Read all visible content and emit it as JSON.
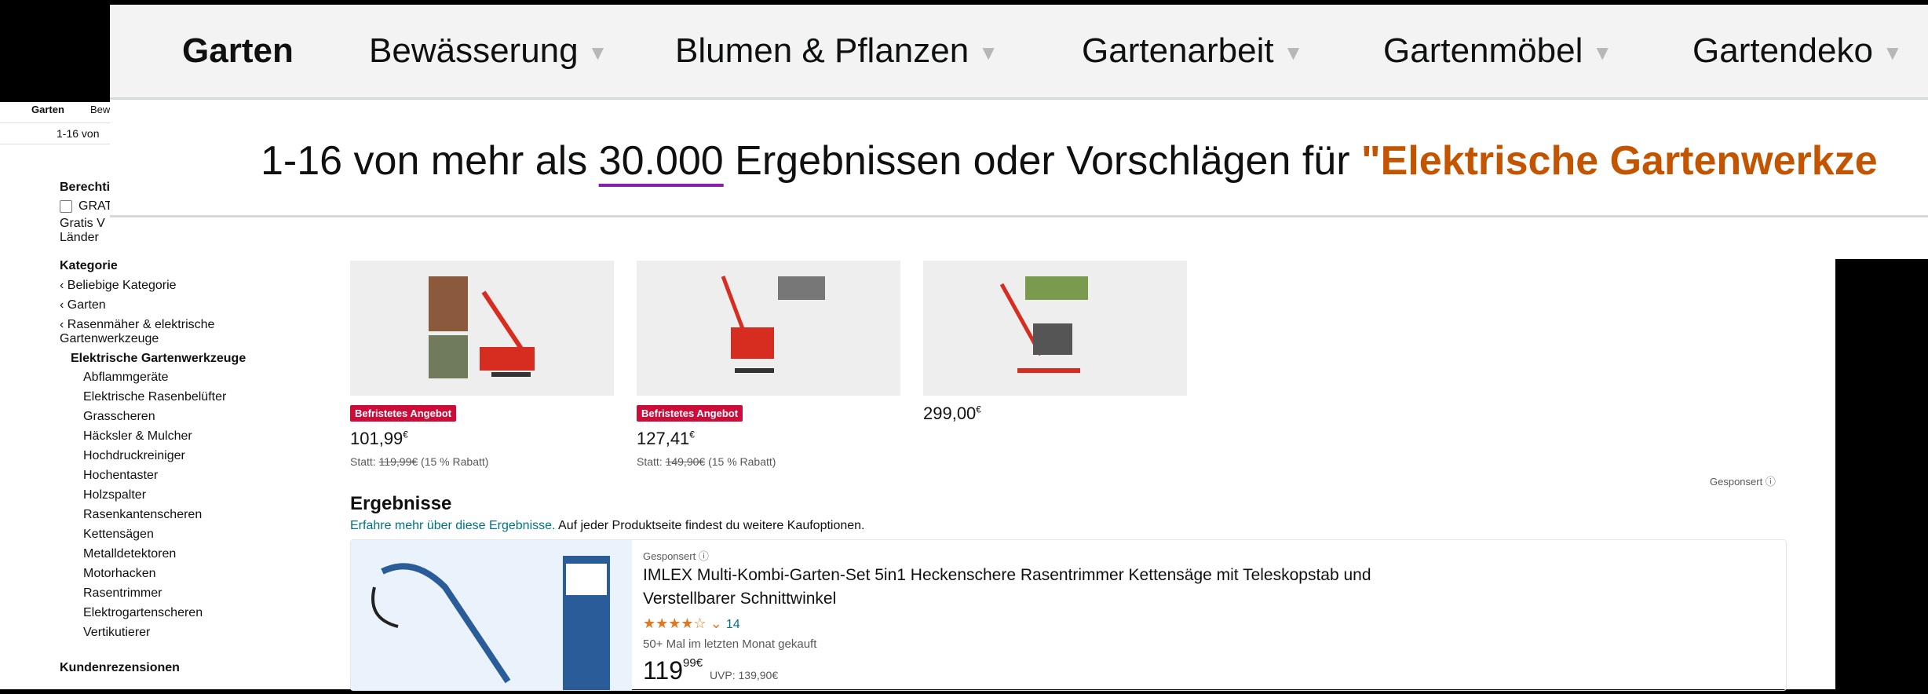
{
  "nav": {
    "items": [
      {
        "label": "Garten",
        "bold": true
      },
      {
        "label": "Bewässerung",
        "caret": true
      },
      {
        "label": "Blumen & Pflanzen",
        "caret": true
      },
      {
        "label": "Gartenarbeit",
        "caret": true
      },
      {
        "label": "Gartenmöbel",
        "caret": true
      },
      {
        "label": "Gartendeko",
        "caret": true
      }
    ],
    "bg_short": [
      "Garten",
      "Bew"
    ]
  },
  "results": {
    "prefix": "1-16 von mehr als ",
    "count": "30.000",
    "middle": " Ergebnissen oder Vorschlägen für ",
    "query": "\"Elektrische Gartenwerkze",
    "bg_short": "1-16 von"
  },
  "sidebar": {
    "berechtigt_title": "Berechti",
    "checkbox_label": "GRAT",
    "gratis_line1": "Gratis V",
    "gratis_line2": "Länder",
    "kategorie_title": "Kategorie",
    "parents": [
      "‹ Beliebige Kategorie",
      "‹ Garten",
      "‹ Rasenmäher & elektrische",
      "Gartenwerkzeuge"
    ],
    "current": "Elektrische Gartenwerkzeuge",
    "subs": [
      "Abflammgeräte",
      "Elektrische Rasenbelüfter",
      "Grasscheren",
      "Häcksler & Mulcher",
      "Hochdruckreiniger",
      "Hochentaster",
      "Holzspalter",
      "Rasenkantenscheren",
      "Kettensägen",
      "Metalldetektoren",
      "Motorhacken",
      "Rasentrimmer",
      "Elektrogartenscheren",
      "Vertikutierer"
    ],
    "reviews_title": "Kundenrezensionen"
  },
  "sponsored_cards": [
    {
      "badge": "Befristetes Angebot",
      "price": "101,99",
      "currency": "€",
      "statt_label": "Statt: ",
      "old": "119,99€",
      "discount": " (15 % Rabatt)"
    },
    {
      "badge": "Befristetes Angebot",
      "price": "127,41",
      "currency": "€",
      "statt_label": "Statt: ",
      "old": "149,90€",
      "discount": " (15 % Rabatt)"
    },
    {
      "badge": "",
      "price": "299,00",
      "currency": "€",
      "statt_label": "",
      "old": "",
      "discount": ""
    }
  ],
  "gesponsert_label": "Gesponsert ⓘ",
  "ergebnisse": {
    "title": "Ergebnisse",
    "link": "Erfahre mehr über diese Ergebnisse.",
    "text": " Auf jeder Produktseite findest du weitere Kaufoptionen."
  },
  "product": {
    "sponsored": "Gesponsert ⓘ",
    "title": "IMLEX Multi-Kombi-Garten-Set 5in1 Heckenschere Rasentrimmer Kettensäge mit Teleskopstab und Verstellbarer Schnittwinkel",
    "stars": "★★★★☆",
    "rating": 4,
    "review_count": "14",
    "bought": "50+ Mal im letzten Monat gekauft",
    "price_whole": "119",
    "price_frac": "99",
    "currency": "€",
    "uvp": "UVP: 139,90€"
  }
}
